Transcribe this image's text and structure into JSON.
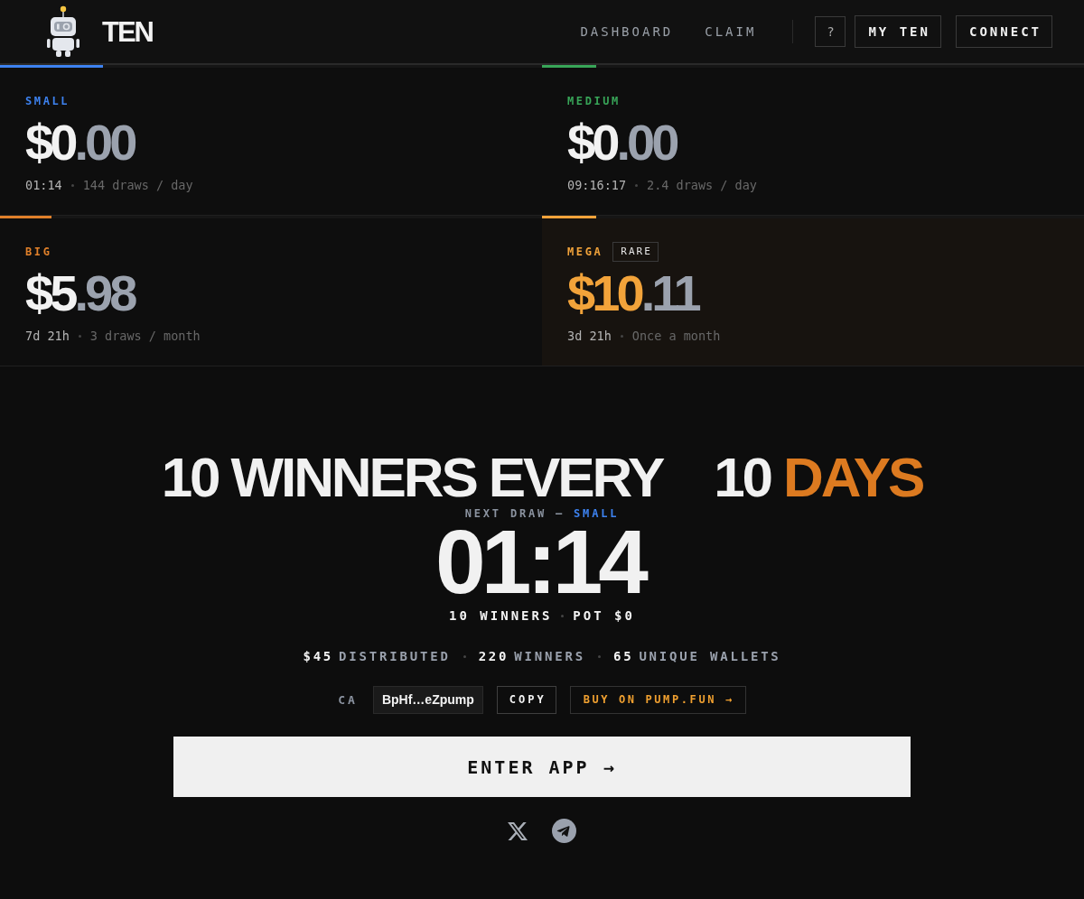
{
  "header": {
    "logo_text": "TEN",
    "nav": [
      {
        "label": "DASHBOARD"
      },
      {
        "label": "CLAIM"
      }
    ],
    "help_button": "?",
    "my_ten_button": "MY TEN",
    "connect_button": "CONNECT"
  },
  "tiers": [
    {
      "name": "SMALL",
      "color": "#3d82f0",
      "level": 0.19,
      "highlighted": false,
      "amount": "$0",
      "amount_decimals": ".00",
      "countdown": "01:14",
      "frequency": "144 draws / day"
    },
    {
      "name": "MEDIUM",
      "color": "#38a558",
      "level": 0.1,
      "highlighted": false,
      "amount": "$0",
      "amount_decimals": ".00",
      "countdown": "09:16:17",
      "frequency": "2.4 draws / day"
    },
    {
      "name": "BIG",
      "color": "#e0802a",
      "level": 0.095,
      "highlighted": false,
      "amount": "$5",
      "amount_decimals": ".98",
      "countdown": "7d 21h",
      "frequency": "3 draws / month"
    },
    {
      "name": "MEGA",
      "badge": "RARE",
      "color": "#f2a33a",
      "level": 0.1,
      "highlighted": true,
      "amount": "$10",
      "amount_decimals": ".11",
      "countdown": "3d 21h",
      "frequency": "Once a month"
    }
  ],
  "hero": {
    "headline": {
      "lead": "10 WINNERS EVERY",
      "count": "10",
      "unit": "DAYS"
    },
    "next_draw": {
      "label": "NEXT DRAW —",
      "tier": "SMALL"
    },
    "countdown": "01:14",
    "round_info": [
      "10 WINNERS",
      "POT $0"
    ],
    "stats": [
      {
        "value": "$45",
        "label": "DISTRIBUTED"
      },
      {
        "value": "220",
        "label": "WINNERS"
      },
      {
        "value": "65",
        "label": "UNIQUE WALLETS"
      }
    ],
    "contract": {
      "label": "CA",
      "address": "BpHf…eZpump",
      "copy_button": "COPY",
      "buy_button": "BUY ON PUMP.FUN →"
    },
    "enter_button": "ENTER APP →"
  }
}
